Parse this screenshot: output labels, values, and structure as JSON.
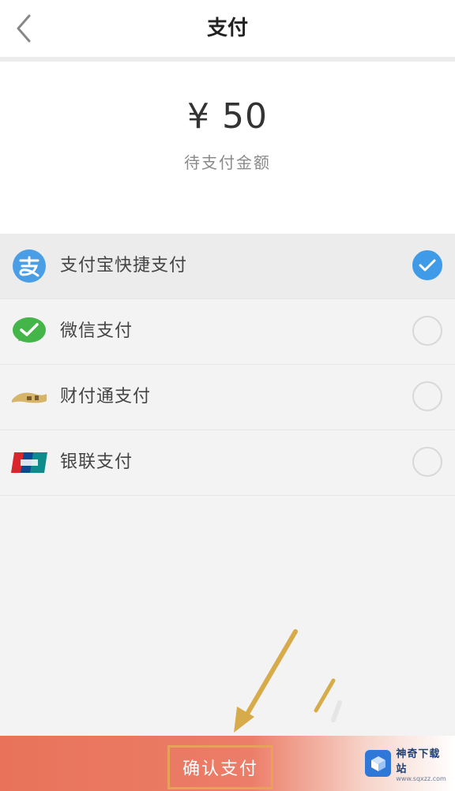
{
  "header": {
    "title": "支付"
  },
  "payment": {
    "amount": "¥ 50",
    "amount_caption": "待支付金额"
  },
  "methods": [
    {
      "label": "支付宝快捷支付",
      "icon": "alipay-icon",
      "selected": true
    },
    {
      "label": "微信支付",
      "icon": "wechat-icon",
      "selected": false
    },
    {
      "label": "财付通支付",
      "icon": "tenpay-icon",
      "selected": false
    },
    {
      "label": "银联支付",
      "icon": "unionpay-icon",
      "selected": false
    }
  ],
  "footer": {
    "confirm_label": "确认支付"
  },
  "watermark": {
    "name": "神奇下载站",
    "url": "www.sqxzz.com"
  },
  "colors": {
    "accent": "#e8735a",
    "selected": "#3f9be8",
    "annotation": "#d8ab4a"
  }
}
